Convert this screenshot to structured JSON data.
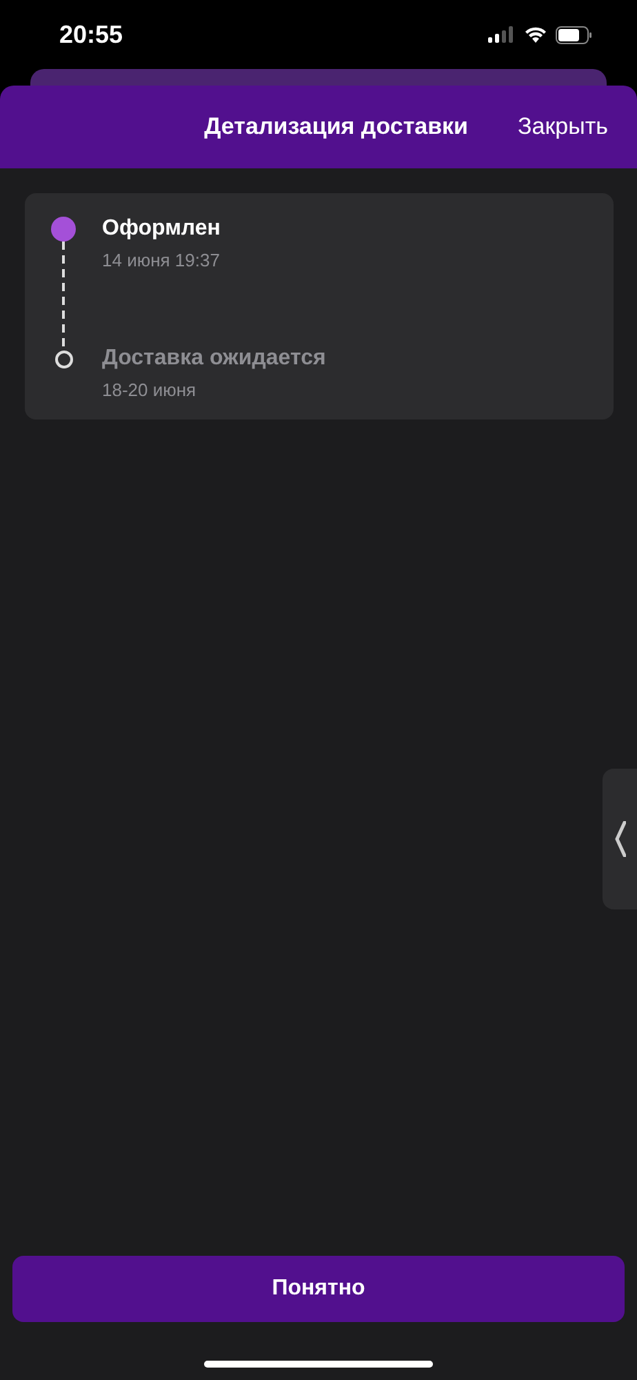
{
  "status_bar": {
    "time": "20:55"
  },
  "header": {
    "title": "Детализация доставки",
    "close": "Закрыть"
  },
  "steps": [
    {
      "title": "Оформлен",
      "subtitle": "14 июня 19:37",
      "done": true
    },
    {
      "title": "Доставка ожидается",
      "subtitle": "18-20 июня",
      "done": false
    }
  ],
  "confirm_button": "Понятно"
}
